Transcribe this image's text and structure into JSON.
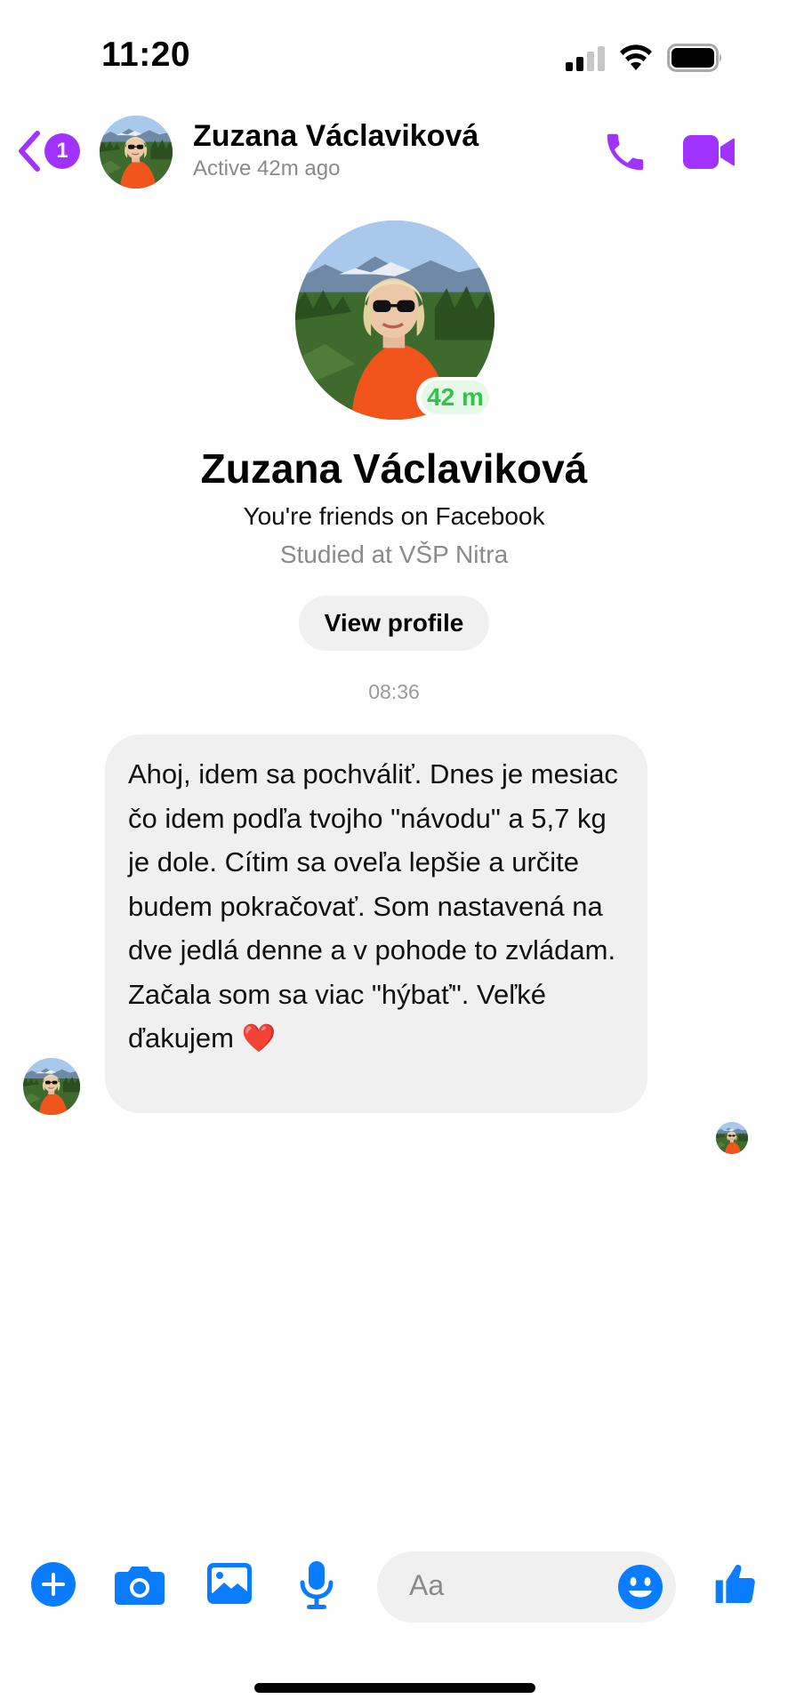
{
  "status_bar": {
    "time": "11:20"
  },
  "header": {
    "back_badge": "1",
    "contact_name": "Zuzana Václaviková",
    "active_status": "Active 42m ago",
    "icons": [
      "back-chevron-icon",
      "phone-icon",
      "video-camera-icon"
    ]
  },
  "profile": {
    "active_chip": "42 m",
    "name": "Zuzana Václaviková",
    "friends_line": "You're friends on Facebook",
    "studied_line": "Studied at VŠP Nitra",
    "view_profile_label": "View profile"
  },
  "conversation": {
    "timestamp": "08:36",
    "messages": [
      {
        "text": "Ahoj, idem sa pochváliť. Dnes je mesiac čo idem podľa tvojho \"návodu\" a 5,7 kg je dole. Cítim sa oveľa lepšie a určite budem pokračovať. Som nastavená na dve jedlá denne a v pohode to zvládam. Začala som sa viac \"hýbať\". Veľké ďakujem ❤️"
      }
    ]
  },
  "composer": {
    "placeholder": "Aa",
    "icons": [
      "plus-icon",
      "camera-icon",
      "image-icon",
      "microphone-icon",
      "emoji-icon",
      "thumbs-up-icon"
    ]
  },
  "colors": {
    "accent_purple": "#a033ff",
    "accent_blue": "#0a7cff",
    "bubble_gray": "#f0f0f0",
    "active_green": "#2fc44a"
  }
}
